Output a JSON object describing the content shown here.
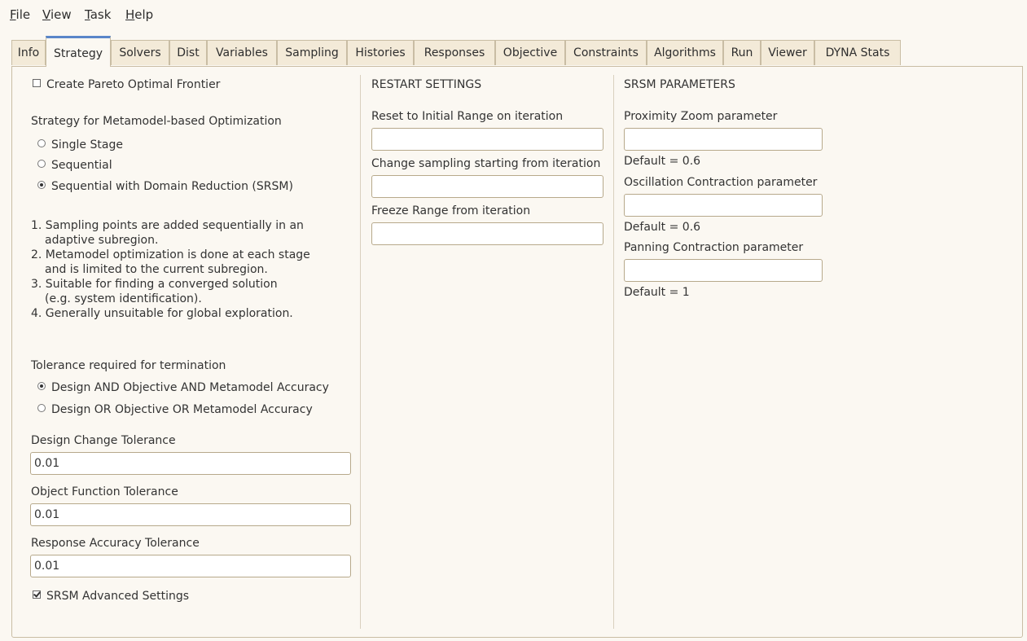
{
  "menu": [
    {
      "label": "File",
      "accel": "F",
      "rest": "ile"
    },
    {
      "label": "View",
      "accel": "V",
      "rest": "iew"
    },
    {
      "label": "Task",
      "accel": "T",
      "rest": "ask"
    },
    {
      "label": "Help",
      "accel": "H",
      "rest": "elp"
    }
  ],
  "tabs": [
    "Info",
    "Strategy",
    "Solvers",
    "Dist",
    "Variables",
    "Sampling",
    "Histories",
    "Responses",
    "Objective",
    "Constraints",
    "Algorithms",
    "Run",
    "Viewer",
    "DYNA Stats"
  ],
  "active_tab": "Strategy",
  "strategy": {
    "pareto_label": "Create Pareto Optimal Frontier",
    "pareto_checked": false,
    "metamodel_heading": "Strategy for Metamodel-based Optimization",
    "options": [
      {
        "label": "Single Stage",
        "selected": false
      },
      {
        "label": "Sequential",
        "selected": false
      },
      {
        "label": "Sequential with Domain Reduction (SRSM)",
        "selected": true
      }
    ],
    "notes": [
      "1. Sampling points are added sequentially in an",
      "   adaptive subregion.",
      "2. Metamodel optimization is done at each stage",
      "   and is limited to the current subregion.",
      "3. Suitable for finding a converged solution",
      "   (e.g. system identification).",
      "4. Generally unsuitable for global exploration."
    ],
    "tolerance_heading": "Tolerance required for termination",
    "tolerance_options": [
      {
        "label": "Design AND Objective AND Metamodel Accuracy",
        "selected": true
      },
      {
        "label": "Design OR Objective OR Metamodel Accuracy",
        "selected": false
      }
    ],
    "design_change_label": "Design Change Tolerance",
    "design_change_value": "0.01",
    "object_function_label": "Object Function Tolerance",
    "object_function_value": "0.01",
    "response_accuracy_label": "Response Accuracy Tolerance",
    "response_accuracy_value": "0.01",
    "srsm_advanced_label": "SRSM Advanced Settings",
    "srsm_advanced_checked": true
  },
  "restart": {
    "heading": "RESTART SETTINGS",
    "reset_label": "Reset to Initial Range on iteration",
    "reset_value": "",
    "change_sampling_label": "Change sampling starting from iteration",
    "change_sampling_value": "",
    "freeze_label": "Freeze Range from iteration",
    "freeze_value": ""
  },
  "srsm": {
    "heading": "SRSM PARAMETERS",
    "proximity_label": "Proximity Zoom parameter",
    "proximity_value": "",
    "proximity_default": "Default = 0.6",
    "oscillation_label": "Oscillation Contraction parameter",
    "oscillation_value": "",
    "oscillation_default": "Default = 0.6",
    "panning_label": "Panning Contraction parameter",
    "panning_value": "",
    "panning_default": "Default = 1"
  }
}
